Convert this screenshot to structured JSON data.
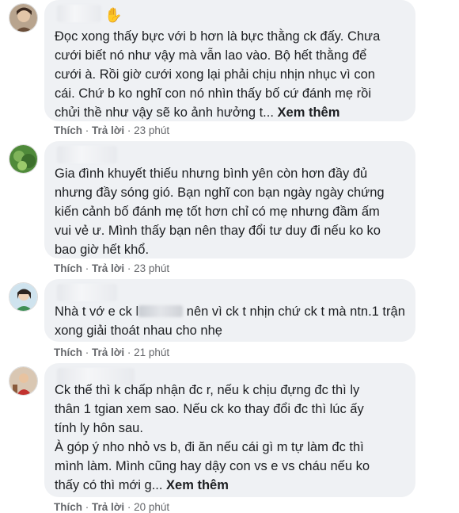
{
  "comments": [
    {
      "text": "Đọc xong thấy bực với b hơn là bực thằng ck đấy. Chưa\ncưới biết nó như vậy mà vẫn lao vào. Bộ hết thằng để\ncưới à. Rồi giờ cưới xong lại phải chịu nhịn nhục vì con\ncái. Chứ b ko nghĩ con nó nhìn thấy bố cứ đánh mẹ rồi\nchửi thề như vậy sẽ ko ảnh hưởng t... ",
      "more": "Xem thêm",
      "like": "Thích",
      "reply": "Trả lời",
      "time": "23 phút"
    },
    {
      "text": "Gia đình khuyết thiếu nhưng bình yên còn hơn đầy đủ\nnhưng đầy sóng gió. Bạn nghĩ con bạn ngày ngày chứng\nkiến cảnh bố đánh mẹ tốt hơn chỉ có mẹ nhưng đầm ấm\nvui vẻ ư. Mình thấy bạn nên thay đổi tư duy đi nếu ko ko\nbao giờ hết khổ.",
      "like": "Thích",
      "reply": "Trả lời",
      "time": "23 phút"
    },
    {
      "text_before": "Nhà t vớ e ck l",
      "text_after": " nên vì ck t nhịn chứ ck t mà ntn.1 trận\nxong giải thoát nhau cho nhẹ",
      "like": "Thích",
      "reply": "Trả lời",
      "time": "21 phút"
    },
    {
      "text": "Ck thế thì k chấp nhận đc r, nếu k chịu đựng đc thì ly\nthân 1 tgian xem sao. Nếu ck ko thay đổi đc thì lúc ấy\ntính ly hôn sau.\nÀ góp ý nho nhỏ vs b, đi ăn nếu cái gì m tự làm đc thì\nmình làm. Mình cũng hay dậy con vs e vs cháu nếu ko\nthấy có thì mới g... ",
      "more": "Xem thêm",
      "like": "Thích",
      "reply": "Trả lời",
      "time": "20 phút"
    }
  ],
  "separator": " · ",
  "icons": {
    "wave": "waving-hand-icon"
  }
}
